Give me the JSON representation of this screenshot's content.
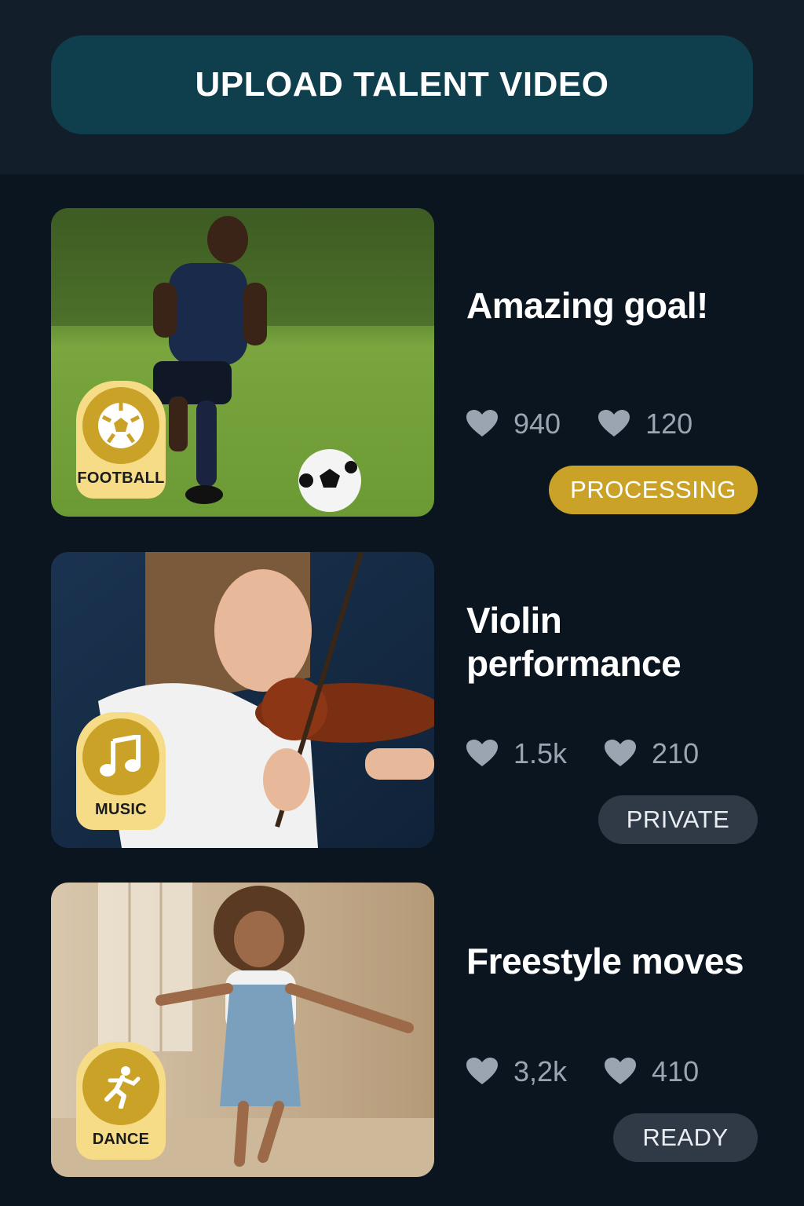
{
  "header": {
    "upload_label": "UPLOAD TALENT VIDEO"
  },
  "videos": [
    {
      "title": "Amazing goal!",
      "category": "FOOTBALL",
      "category_icon": "soccer-ball-icon",
      "likes": "940",
      "second_count": "120",
      "status": "PROCESSING"
    },
    {
      "title": "Violin performance",
      "category": "MUSIC",
      "category_icon": "music-note-icon",
      "likes": "1.5k",
      "second_count": "210",
      "status": "PRIVATE"
    },
    {
      "title": "Freestyle moves",
      "category": "DANCE",
      "category_icon": "dancer-icon",
      "likes": "3,2k",
      "second_count": "410",
      "status": "READY"
    }
  ],
  "colors": {
    "accent": "#c9a227",
    "badge_bg": "#f6dc86",
    "background": "#0b1520",
    "header_button": "#0f3e4d"
  }
}
